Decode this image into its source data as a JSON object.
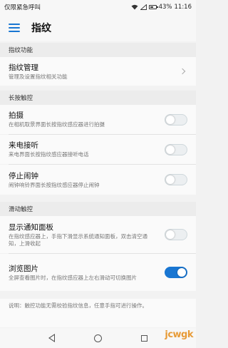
{
  "status_bar": {
    "carrier": "仅限紧急呼叫",
    "battery": "43%",
    "time": "11:16"
  },
  "appbar": {
    "title": "指纹"
  },
  "sections": [
    {
      "header": "指纹功能",
      "rows": [
        {
          "title": "指纹管理",
          "subtitle": "管理及设置指纹相关功能",
          "control": "chevron"
        }
      ]
    },
    {
      "header": "长按触控",
      "rows": [
        {
          "title": "拍摄",
          "subtitle": "在相机取景界面长按指纹感应器进行拍摄",
          "control": "toggle",
          "on": false
        },
        {
          "title": "来电接听",
          "subtitle": "来电界面长按指纹感应器接听电话",
          "control": "toggle",
          "on": false
        },
        {
          "title": "停止闹钟",
          "subtitle": "闹钟响铃界面长按指纹感应器停止闹钟",
          "control": "toggle",
          "on": false
        }
      ]
    },
    {
      "header": "滑动触控",
      "rows": [
        {
          "title": "显示通知面板",
          "subtitle": "在指纹感应器上，手指下滑显示系统通知面板，双击清空通知，上滑收起",
          "control": "toggle",
          "on": false
        },
        {
          "title": "浏览图片",
          "subtitle": "全屏查看图片时，在指纹感应器上左右滑动可切换图片",
          "control": "toggle",
          "on": true
        }
      ]
    }
  ],
  "note": "说明：触控功能无需校验指纹信息，任意手指可进行操作。",
  "watermark": "jcwgk",
  "colors": {
    "accent": "#1976d2",
    "background": "#f2f2f2",
    "section_bg": "#ececec"
  }
}
